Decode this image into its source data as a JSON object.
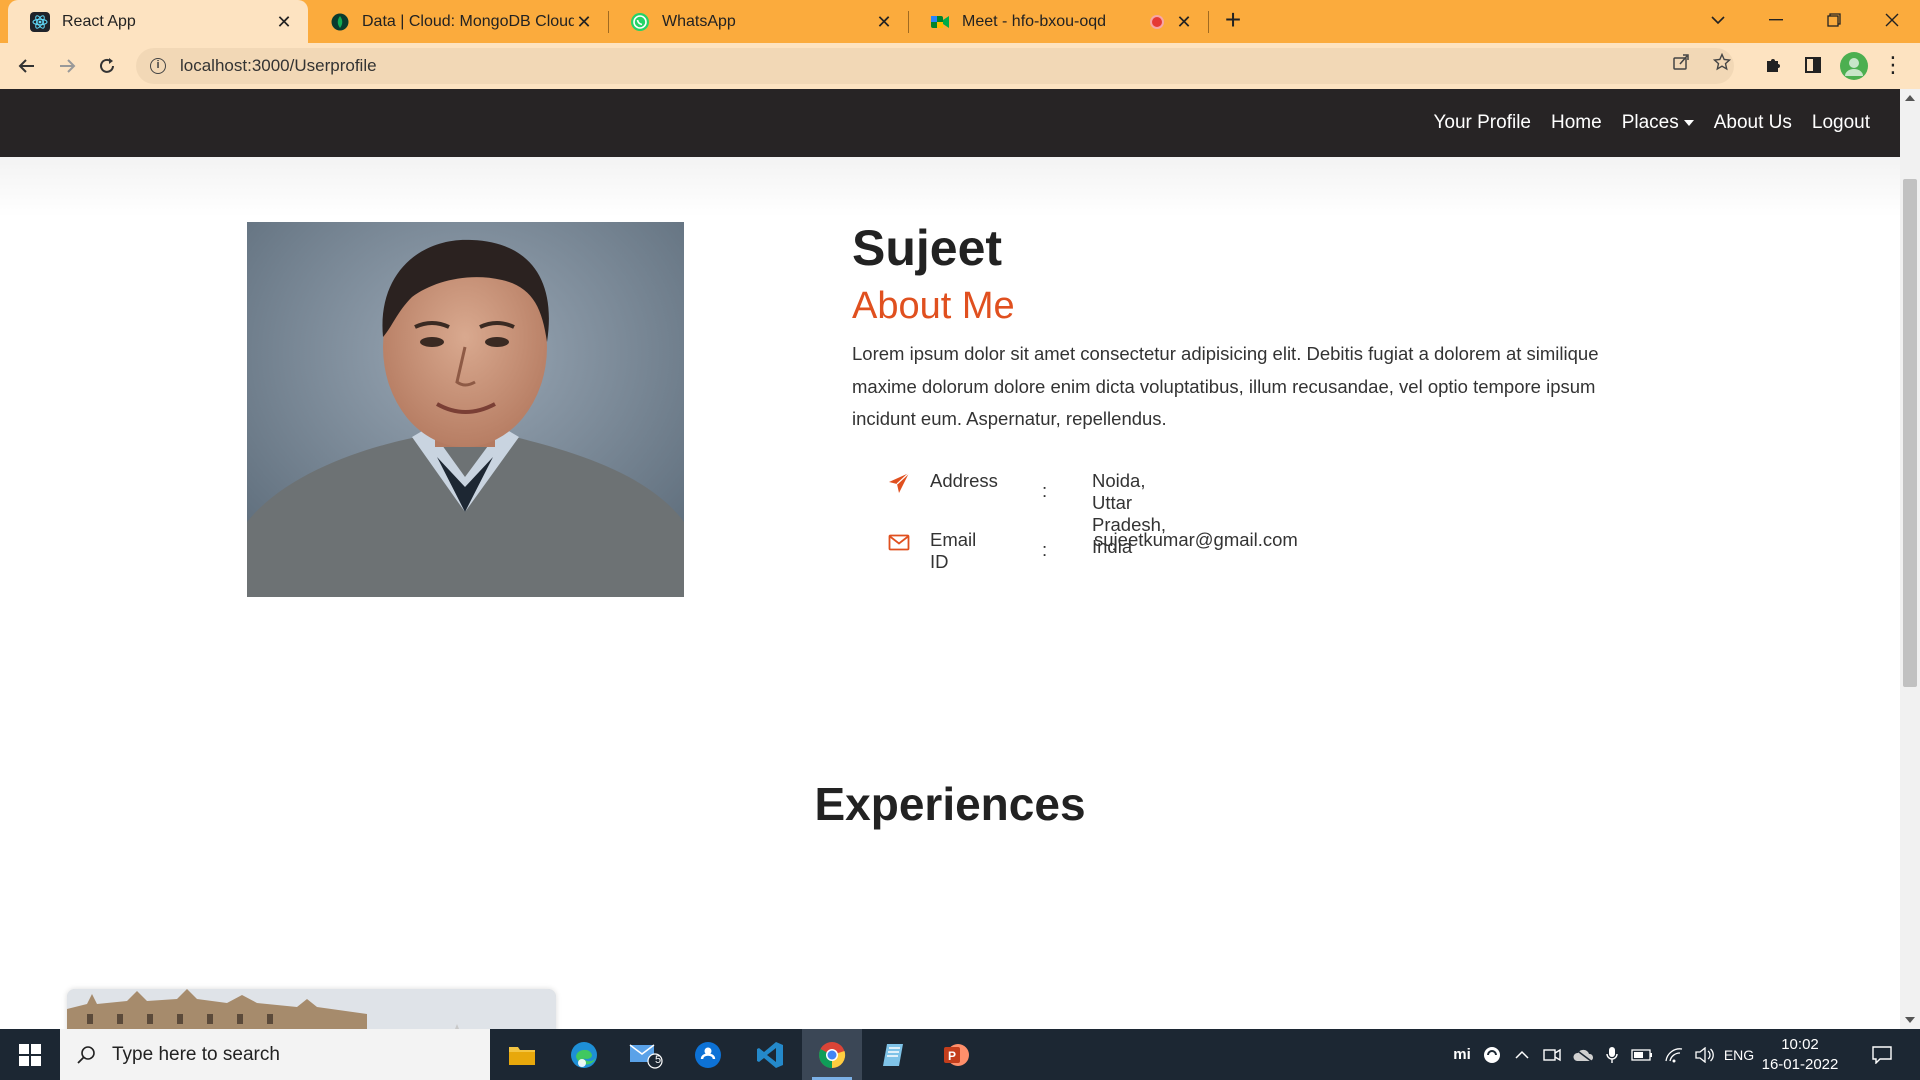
{
  "browser": {
    "tabs": [
      {
        "title": "React App",
        "active": true
      },
      {
        "title": "Data | Cloud: MongoDB Cloud",
        "active": false
      },
      {
        "title": "WhatsApp",
        "active": false
      },
      {
        "title": "Meet - hfo-bxou-oqd",
        "active": false
      }
    ],
    "url": "localhost:3000/Userprofile"
  },
  "navbar": {
    "items": [
      "Your Profile",
      "Home",
      "Places",
      "About Us",
      "Logout"
    ]
  },
  "profile": {
    "name": "Sujeet",
    "about_heading": "About Me",
    "bio": "Lorem ipsum dolor sit amet consectetur adipisicing elit. Debitis fugiat a dolorem at similique maxime dolorum dolore enim dicta voluptatibus, illum recusandae, vel optio tempore ipsum incidunt eum. Aspernatur, repellendus.",
    "details": [
      {
        "label": "Address",
        "separator": ":",
        "value": "Noida, Uttar Pradesh, India",
        "icon": "paper-plane-icon"
      },
      {
        "label": "Email ID",
        "separator": ":",
        "value": "sujeetkumar@gmail.com",
        "icon": "envelope-icon"
      }
    ]
  },
  "experiences": {
    "heading": "Experiences"
  },
  "taskbar": {
    "search_placeholder": "Type here to search",
    "mail_badge": "5",
    "language": "ENG",
    "time": "10:02",
    "date": "16-01-2022"
  },
  "colors": {
    "accent": "#e0501f",
    "navbar_bg": "#272425",
    "tabbar_bg": "#fbab3d"
  }
}
